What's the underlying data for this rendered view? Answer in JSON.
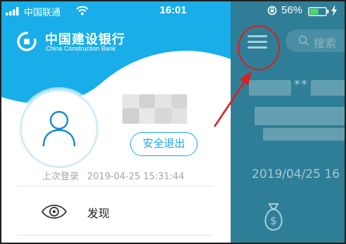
{
  "status_bar": {
    "carrier": "中国联通",
    "time": "16:01",
    "battery_percent": "56%",
    "battery_level": 0.56
  },
  "drawer": {
    "bank": {
      "name_cn": "中国建设银行",
      "name_en": "China Construction Bank"
    },
    "logout_label": "安全退出",
    "last_login": {
      "label": "上次登录",
      "datetime": "2019-04-25 15:31:44"
    },
    "menu_items": [
      {
        "label": "发现",
        "icon": "eye-icon"
      }
    ]
  },
  "main": {
    "search_placeholder": "搜索",
    "masked_number": "**",
    "date": "2019/04/25 16"
  },
  "icons": {
    "menu": "hamburger-menu-icon",
    "user": "user-icon",
    "bank_logo": "ccb-logo-icon",
    "money": "money-bag-icon"
  },
  "colors": {
    "brand_blue": "#1aa6e6",
    "dimmed_main": "#2f7e97",
    "annotation_red": "#e21b1b"
  }
}
